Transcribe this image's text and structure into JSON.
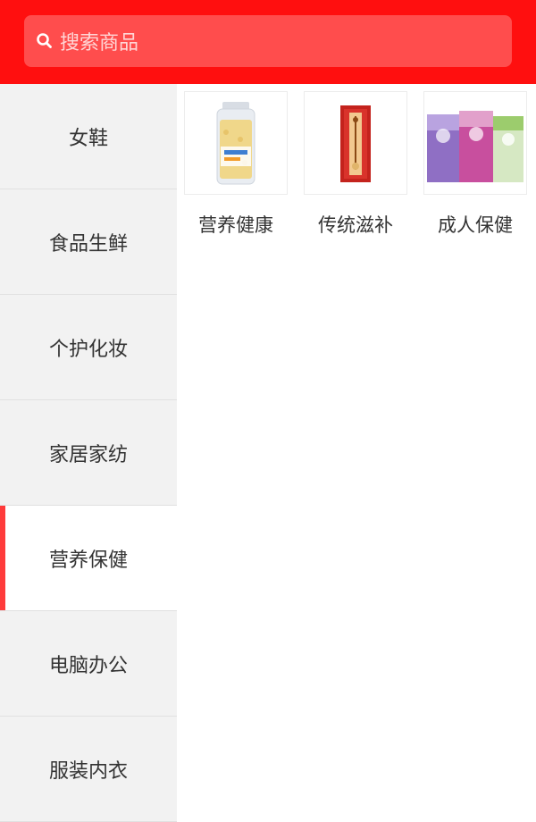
{
  "search": {
    "placeholder": "搜索商品"
  },
  "sidebar": {
    "items": [
      {
        "label": "女鞋"
      },
      {
        "label": "食品生鲜"
      },
      {
        "label": "个护化妆"
      },
      {
        "label": "家居家纺"
      },
      {
        "label": "营养保健",
        "active": true
      },
      {
        "label": "电脑办公"
      },
      {
        "label": "服装内衣"
      }
    ]
  },
  "content": {
    "categories": [
      {
        "label": "营养健康",
        "icon": "oat-jar-product-image"
      },
      {
        "label": "传统滋补",
        "icon": "red-gift-box-product-image"
      },
      {
        "label": "成人保健",
        "icon": "boxed-product-set-image"
      }
    ]
  },
  "colors": {
    "header": "#ff0f0f",
    "search_bg": "#ff4d4d",
    "active_indicator": "#ff3b3b",
    "sidebar_bg": "#f2f2f2"
  }
}
